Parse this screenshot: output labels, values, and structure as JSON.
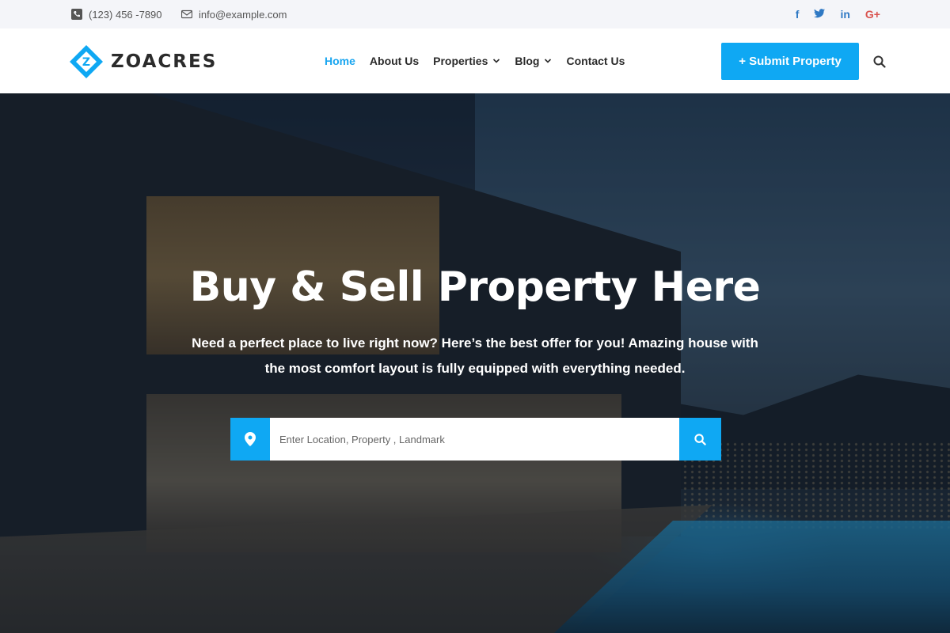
{
  "topbar": {
    "phone": "(123) 456 -7890",
    "email": "info@example.com",
    "social": [
      {
        "icon": "facebook-icon",
        "glyph": "f"
      },
      {
        "icon": "twitter-icon",
        "glyph": "t"
      },
      {
        "icon": "linkedin-icon",
        "glyph": "in"
      },
      {
        "icon": "google-plus-icon",
        "glyph": "G+"
      }
    ]
  },
  "brand": {
    "name": "ZOACRES",
    "accent": "#0fa8f3"
  },
  "nav": {
    "items": [
      {
        "label": "Home",
        "active": true
      },
      {
        "label": "About Us"
      },
      {
        "label": "Properties",
        "dropdown": true
      },
      {
        "label": "Blog",
        "dropdown": true
      },
      {
        "label": "Contact Us"
      }
    ],
    "submit_label": "+ Submit Property"
  },
  "hero": {
    "title": "Buy & Sell Property Here",
    "subtitle": "Need a perfect place to live right now? Here’s the best offer for you! Amazing house with the most comfort layout is fully equipped with everything needed.",
    "search_placeholder": "Enter Location, Property , Landmark"
  }
}
